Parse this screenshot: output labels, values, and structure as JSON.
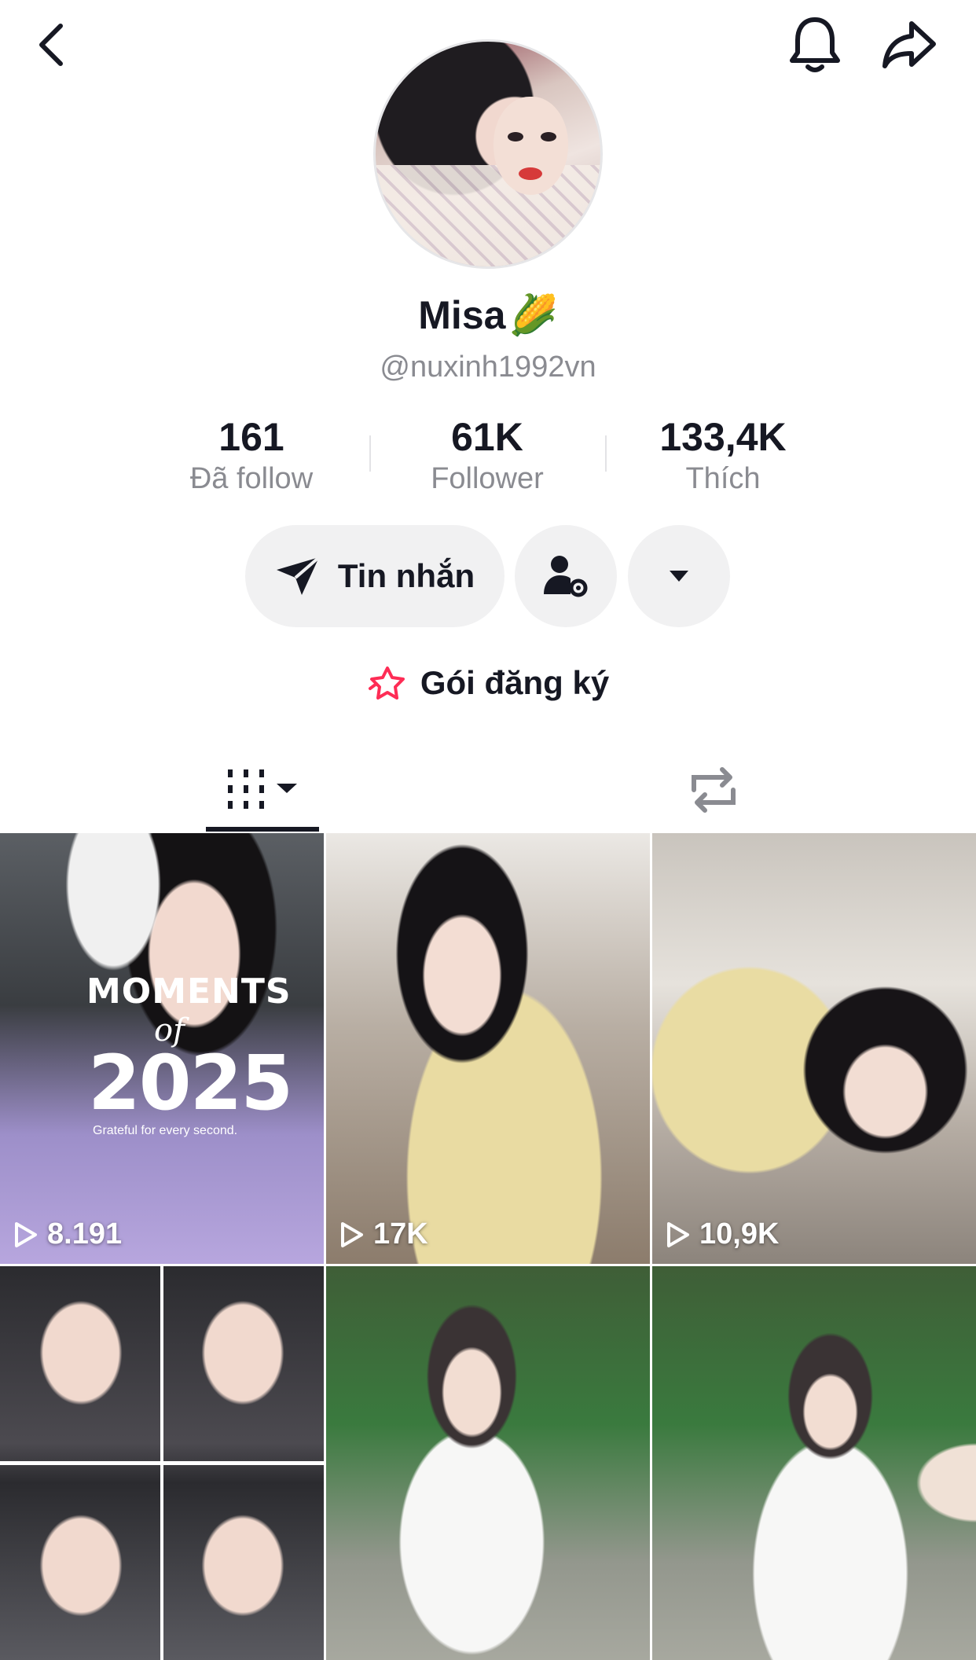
{
  "profile": {
    "display_name": "Misa",
    "name_emoji": "🌽",
    "username": "@nuxinh1992vn"
  },
  "stats": [
    {
      "value": "161",
      "label": "Đã follow"
    },
    {
      "value": "61K",
      "label": "Follower"
    },
    {
      "value": "133,4K",
      "label": "Thích"
    }
  ],
  "actions": {
    "message_label": "Tin nhắn"
  },
  "subscription": {
    "label": "Gói đăng ký"
  },
  "videos": [
    {
      "views": "8.191",
      "overlay": {
        "line1": "MOMENTS",
        "line2": "of",
        "line3": "2025",
        "line4": "Grateful for every second."
      }
    },
    {
      "views": "17K"
    },
    {
      "views": "10,9K"
    },
    {
      "views": ""
    },
    {
      "views": ""
    },
    {
      "views": ""
    }
  ],
  "icons": [
    "back-icon",
    "bell-icon",
    "share-icon",
    "send-icon",
    "person-settings-icon",
    "caret-down-icon",
    "star-icon",
    "grid-icon",
    "repost-icon",
    "play-icon"
  ],
  "colors": {
    "text": "#161823",
    "muted": "#8a8b91",
    "button_bg": "#f1f1f2",
    "accent": "#fe2c55"
  }
}
